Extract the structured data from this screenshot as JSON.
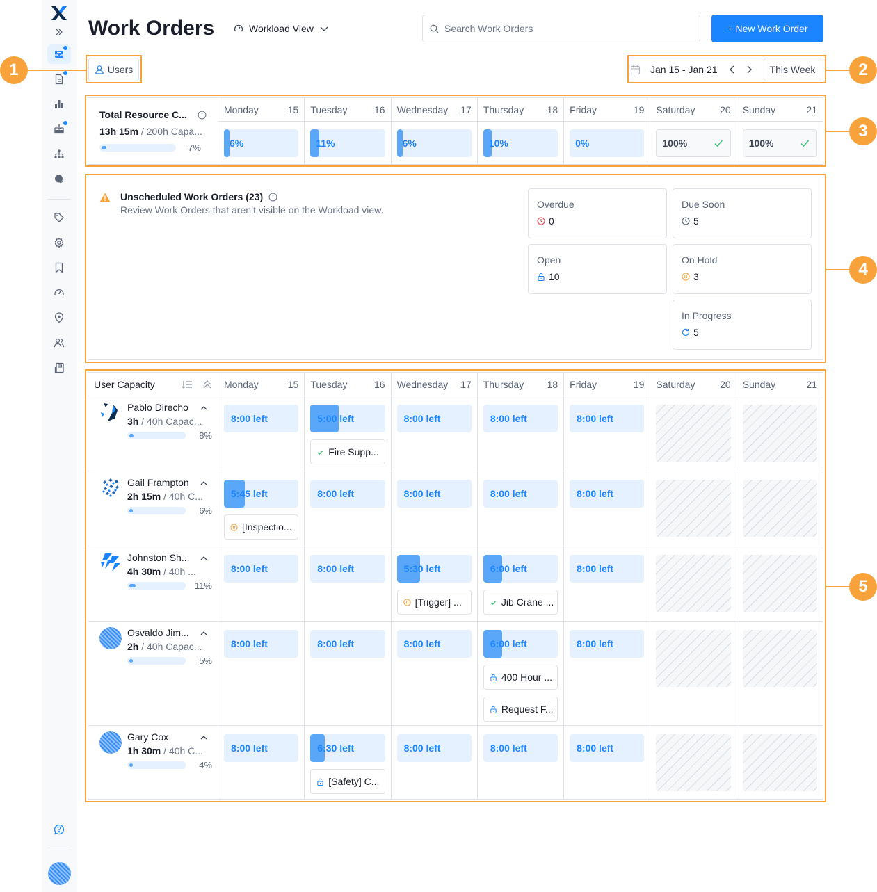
{
  "sidebar": {
    "items": [
      {
        "name": "work-orders",
        "icon": "inbox-tray-icon",
        "active": true,
        "badge": true
      },
      {
        "name": "requests",
        "icon": "document-icon",
        "active": false,
        "badge": true
      },
      {
        "name": "reporting",
        "icon": "bar-chart-icon",
        "active": false,
        "badge": false
      },
      {
        "name": "purchase-orders",
        "icon": "inbox-download-icon",
        "active": false,
        "badge": true
      },
      {
        "name": "assets",
        "icon": "hierarchy-icon",
        "active": false,
        "badge": false
      },
      {
        "name": "messages",
        "icon": "chat-bubble-icon",
        "active": false,
        "badge": false
      },
      {
        "name": "categories",
        "icon": "tag-icon",
        "active": false,
        "badge": false
      },
      {
        "name": "settings",
        "icon": "gear-icon",
        "active": false,
        "badge": false
      },
      {
        "name": "library",
        "icon": "bookmark-icon",
        "active": false,
        "badge": false
      },
      {
        "name": "meters",
        "icon": "gauge-icon",
        "active": false,
        "badge": false
      },
      {
        "name": "locations",
        "icon": "map-pin-icon",
        "active": false,
        "badge": false
      },
      {
        "name": "teams",
        "icon": "users-icon",
        "active": false,
        "badge": false
      },
      {
        "name": "parts",
        "icon": "cabinet-icon",
        "active": false,
        "badge": false
      }
    ],
    "help_icon": "help-chat-icon"
  },
  "header": {
    "title": "Work Orders",
    "view_label": "Workload View",
    "search_placeholder": "Search Work Orders",
    "new_button": "+ New Work Order"
  },
  "filters": {
    "users_label": "Users",
    "date_range": "Jan 15 - Jan 21",
    "this_week": "This Week"
  },
  "annotations": [
    "1",
    "2",
    "3",
    "4",
    "5"
  ],
  "days": [
    {
      "name": "Monday",
      "date": "15"
    },
    {
      "name": "Tuesday",
      "date": "16"
    },
    {
      "name": "Wednesday",
      "date": "17"
    },
    {
      "name": "Thursday",
      "date": "18"
    },
    {
      "name": "Friday",
      "date": "19"
    },
    {
      "name": "Saturday",
      "date": "20"
    },
    {
      "name": "Sunday",
      "date": "21"
    }
  ],
  "total": {
    "title": "Total Resource C...",
    "hours": "13h 15m",
    "capacity": "/ 200h Capa...",
    "percent_label": "7%",
    "percent": 7,
    "daily": [
      {
        "label": "6%",
        "value": 6,
        "done": false
      },
      {
        "label": "11%",
        "value": 11,
        "done": false
      },
      {
        "label": "6%",
        "value": 6,
        "done": false
      },
      {
        "label": "10%",
        "value": 10,
        "done": false
      },
      {
        "label": "0%",
        "value": 0,
        "done": false
      },
      {
        "label": "100%",
        "value": 100,
        "done": true
      },
      {
        "label": "100%",
        "value": 100,
        "done": true
      }
    ]
  },
  "unscheduled": {
    "title": "Unscheduled Work Orders (23)",
    "description": "Review Work Orders that aren’t visible on the Workload view.",
    "stats": [
      {
        "label": "Overdue",
        "value": "0",
        "icon": "clock-icon",
        "color": "#e5484d"
      },
      {
        "label": "Due Soon",
        "value": "5",
        "icon": "clock-icon",
        "color": "#5b6578"
      },
      {
        "label": "Open",
        "value": "10",
        "icon": "unlock-icon",
        "color": "#1a85ff"
      },
      {
        "label": "On Hold",
        "value": "3",
        "icon": "pause-circle-icon",
        "color": "#f7a23b"
      },
      {
        "label": "In Progress",
        "value": "5",
        "icon": "refresh-icon",
        "color": "#1a85ff"
      }
    ]
  },
  "user_capacity": {
    "header": "User Capacity",
    "users": [
      {
        "name": "Pablo Direcho",
        "hours": "3h",
        "capacity": "/ 40h Capac...",
        "percent_label": "8%",
        "percent": 8,
        "days": [
          {
            "left": "8:00 left",
            "used": 0
          },
          {
            "left": "5:00 left",
            "used": 37.5,
            "orders": [
              {
                "title": "Fire Supp...",
                "status": "done"
              }
            ]
          },
          {
            "left": "8:00 left",
            "used": 0
          },
          {
            "left": "8:00 left",
            "used": 0
          },
          {
            "left": "8:00 left",
            "used": 0
          }
        ]
      },
      {
        "name": "Gail Frampton",
        "hours": "2h 15m",
        "capacity": "/ 40h C...",
        "percent_label": "6%",
        "percent": 6,
        "days": [
          {
            "left": "5:45 left",
            "used": 28,
            "orders": [
              {
                "title": "[Inspectio...",
                "status": "hold"
              }
            ]
          },
          {
            "left": "8:00 left",
            "used": 0
          },
          {
            "left": "8:00 left",
            "used": 0
          },
          {
            "left": "8:00 left",
            "used": 0
          },
          {
            "left": "8:00 left",
            "used": 0
          }
        ]
      },
      {
        "name": "Johnston Sh...",
        "hours": "4h 30m",
        "capacity": "/ 40h ...",
        "percent_label": "11%",
        "percent": 11,
        "days": [
          {
            "left": "8:00 left",
            "used": 0
          },
          {
            "left": "8:00 left",
            "used": 0
          },
          {
            "left": "5:30 left",
            "used": 31,
            "orders": [
              {
                "title": "[Trigger] ...",
                "status": "hold"
              }
            ]
          },
          {
            "left": "6:00 left",
            "used": 25,
            "orders": [
              {
                "title": "Jib Crane ...",
                "status": "done"
              }
            ]
          },
          {
            "left": "8:00 left",
            "used": 0
          }
        ]
      },
      {
        "name": "Osvaldo Jim...",
        "hours": "2h",
        "capacity": "/ 40h Capac...",
        "percent_label": "5%",
        "percent": 5,
        "days": [
          {
            "left": "8:00 left",
            "used": 0
          },
          {
            "left": "8:00 left",
            "used": 0
          },
          {
            "left": "8:00 left",
            "used": 0
          },
          {
            "left": "6:00 left",
            "used": 25,
            "orders": [
              {
                "title": "400 Hour ...",
                "status": "open"
              },
              {
                "title": "Request F...",
                "status": "open"
              }
            ]
          },
          {
            "left": "8:00 left",
            "used": 0
          }
        ]
      },
      {
        "name": "Gary Cox",
        "hours": "1h 30m",
        "capacity": "/ 40h C...",
        "percent_label": "4%",
        "percent": 4,
        "days": [
          {
            "left": "8:00 left",
            "used": 0
          },
          {
            "left": "6:30 left",
            "used": 19,
            "orders": [
              {
                "title": "[Safety] C...",
                "status": "open"
              }
            ]
          },
          {
            "left": "8:00 left",
            "used": 0
          },
          {
            "left": "8:00 left",
            "used": 0
          },
          {
            "left": "8:00 left",
            "used": 0
          }
        ]
      }
    ]
  },
  "colors": {
    "accent": "#1a85ff",
    "annotation": "#f7a23b",
    "success": "#2fbf71",
    "danger": "#e5484d"
  }
}
